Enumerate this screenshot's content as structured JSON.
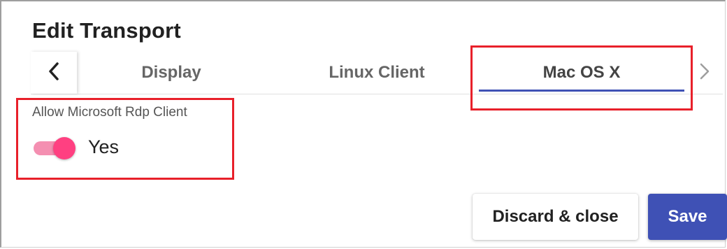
{
  "dialog": {
    "title": "Edit Transport"
  },
  "tabs": {
    "items": [
      {
        "label": "Display"
      },
      {
        "label": "Linux Client"
      },
      {
        "label": "Mac OS X"
      }
    ],
    "active": "Mac OS X",
    "scroll_left_icon": "chevron-left-icon",
    "scroll_right_icon": "chevron-right-icon"
  },
  "field": {
    "label": "Allow Microsoft Rdp Client",
    "toggle_on": true,
    "value_text": "Yes"
  },
  "actions": {
    "discard_label": "Discard & close",
    "save_label": "Save"
  },
  "colors": {
    "accent": "#3f51b5",
    "toggle_on": "#ff4081",
    "highlight": "#e8202a"
  }
}
